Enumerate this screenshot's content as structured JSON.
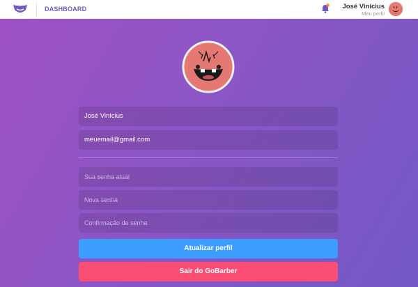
{
  "header": {
    "nav_label": "DASHBOARD",
    "user_name": "José Vinícius",
    "profile_link": "Meu perfil"
  },
  "form": {
    "name_value": "José Vinícius",
    "email_value": "meuemail@gmail.com",
    "current_password_placeholder": "Sua senha atual",
    "new_password_placeholder": "Nova senha",
    "confirm_password_placeholder": "Confirmação de senha",
    "update_button": "Atualizar perfil",
    "logout_button": "Sair do GoBarber"
  },
  "colors": {
    "brand": "#7159c1",
    "update_button": "#3b9eff",
    "logout_button": "#fb4e75",
    "avatar_bg": "#e57872"
  },
  "icons": [
    "logo-icon",
    "bell-icon",
    "avatar"
  ]
}
